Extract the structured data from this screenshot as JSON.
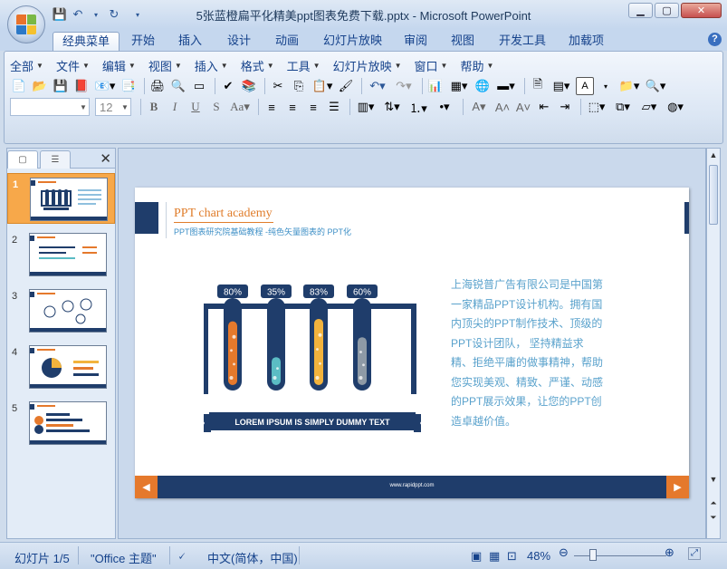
{
  "window": {
    "title": "5张蓝橙扁平化精美ppt图表免费下载.pptx - Microsoft PowerPoint",
    "controls": {
      "minimize": "▭",
      "maximize": "▢",
      "close": "✕"
    }
  },
  "ribbon_tabs": [
    "经典菜单",
    "开始",
    "插入",
    "设计",
    "动画",
    "幻灯片放映",
    "审阅",
    "视图",
    "开发工具",
    "加载项"
  ],
  "active_tab": "经典菜单",
  "menu": [
    "全部",
    "文件",
    "编辑",
    "视图",
    "插入",
    "格式",
    "工具",
    "幻灯片放映",
    "窗口",
    "帮助"
  ],
  "format_bar": {
    "font_placeholder": "",
    "font_size": "12",
    "bold": "B",
    "italic": "I",
    "underline": "U",
    "strike": "S",
    "case": "Aa"
  },
  "thumbnails": [
    {
      "num": "1",
      "selected": true
    },
    {
      "num": "2",
      "selected": false
    },
    {
      "num": "3",
      "selected": false
    },
    {
      "num": "4",
      "selected": false
    },
    {
      "num": "5",
      "selected": false
    }
  ],
  "slide": {
    "title": "PPT chart academy",
    "subtitle": "PPT图表研究院基础教程 -纯色矢量图表的 PPT化",
    "tubes": [
      {
        "label": "80%",
        "value": 80,
        "color": "#e5792c"
      },
      {
        "label": "35%",
        "value": 35,
        "color": "#5bbcc4"
      },
      {
        "label": "83%",
        "value": 83,
        "color": "#f2b33d"
      },
      {
        "label": "60%",
        "value": 60,
        "color": "#8e9aa6"
      }
    ],
    "banner": "LOREM IPSUM IS SIMPLY DUMMY TEXT",
    "body": "上海锐普广告有限公司是中国第一家精品PPT设计机构。拥有国内顶尖的PPT制作技术、顶级的PPT设计团队， 坚持精益求精、拒绝平庸的做事精神，帮助您实现美观、精致、严谨、动感的PPT展示效果，让您的PPT创造卓越价值。",
    "footer_url": "www.rapidppt.com",
    "prev": "◀",
    "next": "▶"
  },
  "status": {
    "slide_info": "幻灯片 1/5",
    "theme": "\"Office 主题\"",
    "language": "中文(简体，中国)",
    "zoom": "48%"
  },
  "colors": {
    "navy": "#1f3d6b",
    "orange": "#e5792c"
  }
}
